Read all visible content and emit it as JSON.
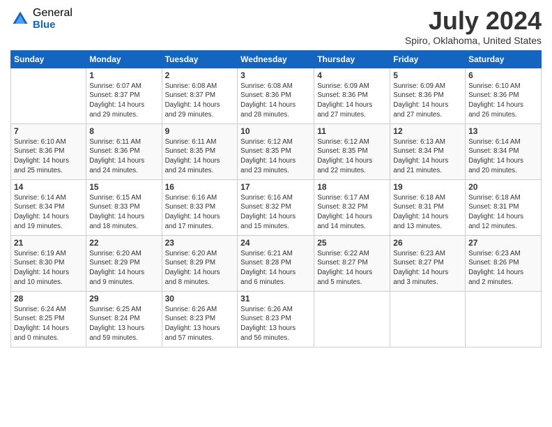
{
  "logo": {
    "general": "General",
    "blue": "Blue"
  },
  "title": "July 2024",
  "subtitle": "Spiro, Oklahoma, United States",
  "headers": [
    "Sunday",
    "Monday",
    "Tuesday",
    "Wednesday",
    "Thursday",
    "Friday",
    "Saturday"
  ],
  "weeks": [
    [
      {
        "day": "",
        "info": ""
      },
      {
        "day": "1",
        "info": "Sunrise: 6:07 AM\nSunset: 8:37 PM\nDaylight: 14 hours\nand 29 minutes."
      },
      {
        "day": "2",
        "info": "Sunrise: 6:08 AM\nSunset: 8:37 PM\nDaylight: 14 hours\nand 29 minutes."
      },
      {
        "day": "3",
        "info": "Sunrise: 6:08 AM\nSunset: 8:36 PM\nDaylight: 14 hours\nand 28 minutes."
      },
      {
        "day": "4",
        "info": "Sunrise: 6:09 AM\nSunset: 8:36 PM\nDaylight: 14 hours\nand 27 minutes."
      },
      {
        "day": "5",
        "info": "Sunrise: 6:09 AM\nSunset: 8:36 PM\nDaylight: 14 hours\nand 27 minutes."
      },
      {
        "day": "6",
        "info": "Sunrise: 6:10 AM\nSunset: 8:36 PM\nDaylight: 14 hours\nand 26 minutes."
      }
    ],
    [
      {
        "day": "7",
        "info": "Sunrise: 6:10 AM\nSunset: 8:36 PM\nDaylight: 14 hours\nand 25 minutes."
      },
      {
        "day": "8",
        "info": "Sunrise: 6:11 AM\nSunset: 8:36 PM\nDaylight: 14 hours\nand 24 minutes."
      },
      {
        "day": "9",
        "info": "Sunrise: 6:11 AM\nSunset: 8:35 PM\nDaylight: 14 hours\nand 24 minutes."
      },
      {
        "day": "10",
        "info": "Sunrise: 6:12 AM\nSunset: 8:35 PM\nDaylight: 14 hours\nand 23 minutes."
      },
      {
        "day": "11",
        "info": "Sunrise: 6:12 AM\nSunset: 8:35 PM\nDaylight: 14 hours\nand 22 minutes."
      },
      {
        "day": "12",
        "info": "Sunrise: 6:13 AM\nSunset: 8:34 PM\nDaylight: 14 hours\nand 21 minutes."
      },
      {
        "day": "13",
        "info": "Sunrise: 6:14 AM\nSunset: 8:34 PM\nDaylight: 14 hours\nand 20 minutes."
      }
    ],
    [
      {
        "day": "14",
        "info": "Sunrise: 6:14 AM\nSunset: 8:34 PM\nDaylight: 14 hours\nand 19 minutes."
      },
      {
        "day": "15",
        "info": "Sunrise: 6:15 AM\nSunset: 8:33 PM\nDaylight: 14 hours\nand 18 minutes."
      },
      {
        "day": "16",
        "info": "Sunrise: 6:16 AM\nSunset: 8:33 PM\nDaylight: 14 hours\nand 17 minutes."
      },
      {
        "day": "17",
        "info": "Sunrise: 6:16 AM\nSunset: 8:32 PM\nDaylight: 14 hours\nand 15 minutes."
      },
      {
        "day": "18",
        "info": "Sunrise: 6:17 AM\nSunset: 8:32 PM\nDaylight: 14 hours\nand 14 minutes."
      },
      {
        "day": "19",
        "info": "Sunrise: 6:18 AM\nSunset: 8:31 PM\nDaylight: 14 hours\nand 13 minutes."
      },
      {
        "day": "20",
        "info": "Sunrise: 6:18 AM\nSunset: 8:31 PM\nDaylight: 14 hours\nand 12 minutes."
      }
    ],
    [
      {
        "day": "21",
        "info": "Sunrise: 6:19 AM\nSunset: 8:30 PM\nDaylight: 14 hours\nand 10 minutes."
      },
      {
        "day": "22",
        "info": "Sunrise: 6:20 AM\nSunset: 8:29 PM\nDaylight: 14 hours\nand 9 minutes."
      },
      {
        "day": "23",
        "info": "Sunrise: 6:20 AM\nSunset: 8:29 PM\nDaylight: 14 hours\nand 8 minutes."
      },
      {
        "day": "24",
        "info": "Sunrise: 6:21 AM\nSunset: 8:28 PM\nDaylight: 14 hours\nand 6 minutes."
      },
      {
        "day": "25",
        "info": "Sunrise: 6:22 AM\nSunset: 8:27 PM\nDaylight: 14 hours\nand 5 minutes."
      },
      {
        "day": "26",
        "info": "Sunrise: 6:23 AM\nSunset: 8:27 PM\nDaylight: 14 hours\nand 3 minutes."
      },
      {
        "day": "27",
        "info": "Sunrise: 6:23 AM\nSunset: 8:26 PM\nDaylight: 14 hours\nand 2 minutes."
      }
    ],
    [
      {
        "day": "28",
        "info": "Sunrise: 6:24 AM\nSunset: 8:25 PM\nDaylight: 14 hours\nand 0 minutes."
      },
      {
        "day": "29",
        "info": "Sunrise: 6:25 AM\nSunset: 8:24 PM\nDaylight: 13 hours\nand 59 minutes."
      },
      {
        "day": "30",
        "info": "Sunrise: 6:26 AM\nSunset: 8:23 PM\nDaylight: 13 hours\nand 57 minutes."
      },
      {
        "day": "31",
        "info": "Sunrise: 6:26 AM\nSunset: 8:23 PM\nDaylight: 13 hours\nand 56 minutes."
      },
      {
        "day": "",
        "info": ""
      },
      {
        "day": "",
        "info": ""
      },
      {
        "day": "",
        "info": ""
      }
    ]
  ]
}
